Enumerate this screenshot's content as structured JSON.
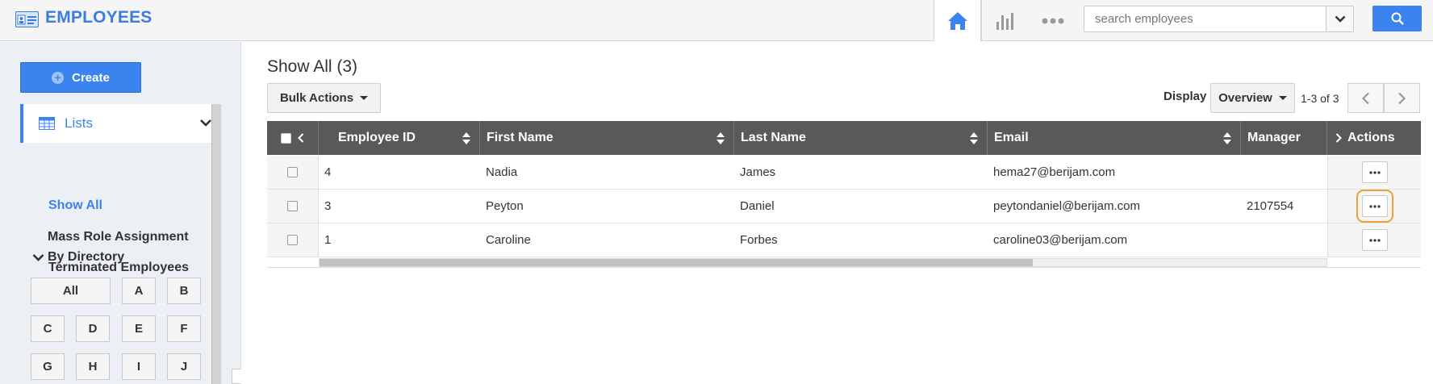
{
  "app": {
    "title": "EMPLOYEES"
  },
  "topbar": {
    "icons": [
      "home-icon",
      "bar-chart-icon",
      "more-dots-icon"
    ],
    "search": {
      "placeholder": "search employees",
      "value": ""
    }
  },
  "sidebar": {
    "create_label": "Create",
    "lists_label": "Lists",
    "items": [
      {
        "label": "Show All",
        "active": true
      },
      {
        "label": "Mass Role Assignment",
        "active": false
      },
      {
        "label": "Terminated Employees",
        "active": false
      }
    ],
    "directory_label": "By Directory",
    "letters": [
      "All",
      "A",
      "B",
      "C",
      "D",
      "E",
      "F",
      "G",
      "H",
      "I",
      "J"
    ]
  },
  "main": {
    "title": "Show All (3)",
    "bulk_actions_label": "Bulk Actions",
    "display_label": "Display",
    "display_value": "Overview",
    "pager_text": "1-3 of 3"
  },
  "table": {
    "columns": [
      "Employee ID",
      "First Name",
      "Last Name",
      "Email",
      "Manager",
      "Actions"
    ],
    "rows": [
      {
        "id": "4",
        "first": "Nadia",
        "last": "James",
        "email": "hema27@berijam.com",
        "manager": ""
      },
      {
        "id": "3",
        "first": "Peyton",
        "last": "Daniel",
        "email": "peytondaniel@berijam.com",
        "manager": "2107554"
      },
      {
        "id": "1",
        "first": "Caroline",
        "last": "Forbes",
        "email": "caroline03@berijam.com",
        "manager": ""
      }
    ]
  },
  "colors": {
    "accent": "#3b84f0",
    "header_bg": "#595959",
    "focus": "#f0a030"
  }
}
